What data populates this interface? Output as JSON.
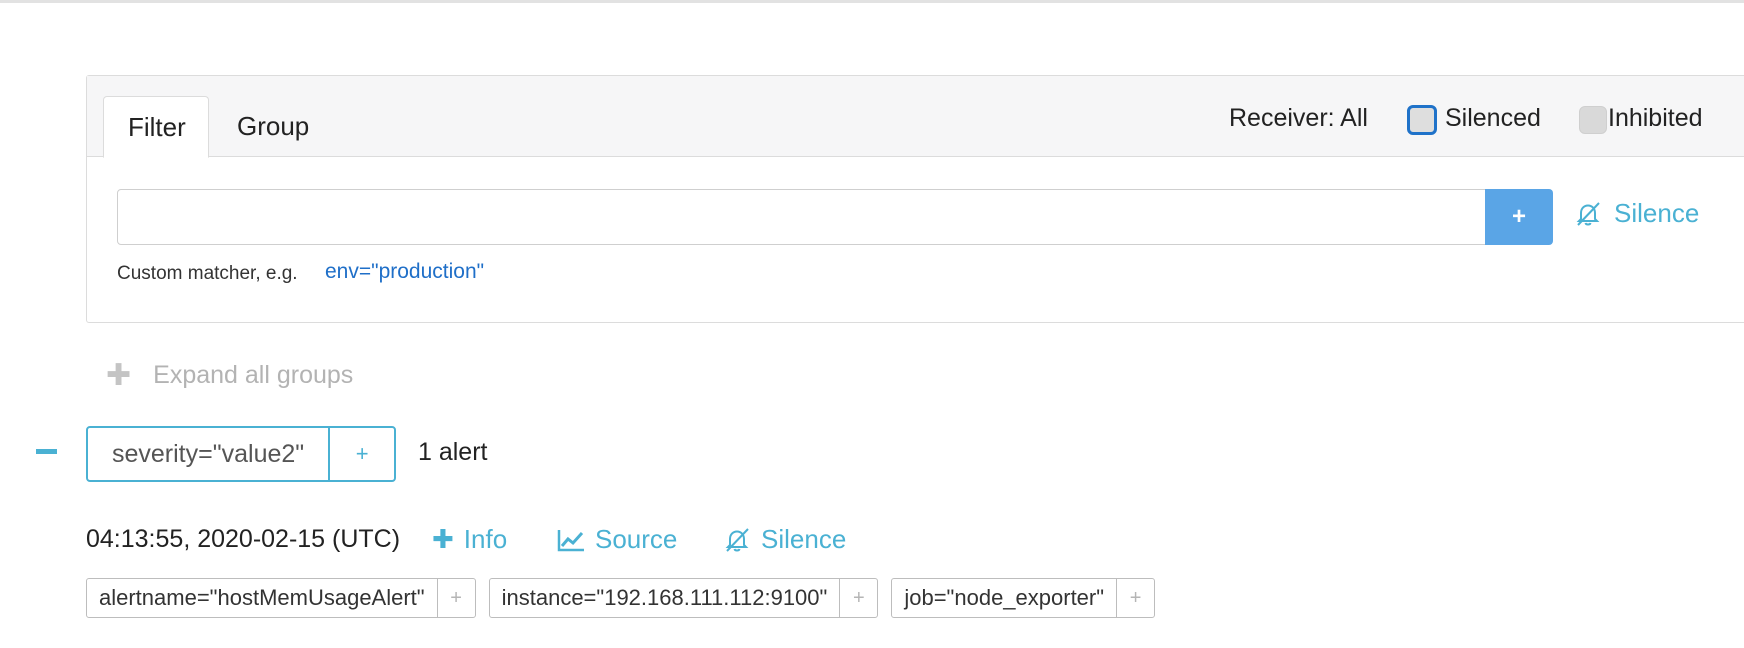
{
  "filter_panel": {
    "tabs": [
      {
        "label": "Filter",
        "active": true
      },
      {
        "label": "Group",
        "active": false
      }
    ],
    "receiver_label": "Receiver: All",
    "silenced_label": "Silenced",
    "inhibited_label": "Inhibited",
    "matcher_input_value": "",
    "add_button_label": "+",
    "silence_label": "Silence",
    "hint_text": "Custom matcher, e.g.",
    "hint_example": "env=\"production\""
  },
  "expand_all_label": "Expand all groups",
  "group": {
    "label": "severity=\"value2\"",
    "plus": "+",
    "alert_count": "1 alert"
  },
  "alert": {
    "timestamp": "04:13:55, 2020-02-15 (UTC)",
    "info_label": "Info",
    "source_label": "Source",
    "silence_label": "Silence",
    "labels": [
      {
        "text": "alertname=\"hostMemUsageAlert\"",
        "plus": "+"
      },
      {
        "text": "instance=\"192.168.111.112:9100\"",
        "plus": "+"
      },
      {
        "text": "job=\"node_exporter\"",
        "plus": "+"
      }
    ]
  },
  "colors": {
    "accent": "#4ab1d3",
    "button_blue": "#5aa5e6",
    "link_blue": "#1f6fc8",
    "muted": "#b3b3b3"
  },
  "icons": {
    "add": "plus-icon",
    "silence": "bell-slash-icon",
    "source": "line-chart-icon",
    "collapse": "minus-icon"
  }
}
